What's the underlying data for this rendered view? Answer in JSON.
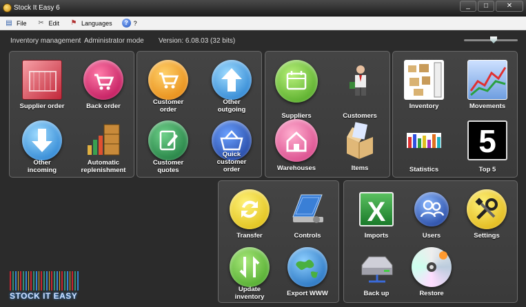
{
  "window": {
    "title": "Stock It Easy 6",
    "controls": {
      "minimize": "_",
      "maximize": "□",
      "close": "✕"
    }
  },
  "menu": {
    "items": [
      {
        "label": "File",
        "icon": "file-icon"
      },
      {
        "label": "Edit",
        "icon": "edit-tools-icon"
      },
      {
        "label": "Languages",
        "icon": "languages-icon"
      },
      {
        "label": "?",
        "icon": "help-icon"
      }
    ]
  },
  "info": {
    "mode": "Inventory management",
    "role": "Administrator mode",
    "version": "Version: 6.08.03 (32 bits)"
  },
  "panels": {
    "orders": [
      {
        "label": "Supplier order",
        "icon": "supplier-order-icon"
      },
      {
        "label": "Back order",
        "icon": "back-order-cart-icon"
      },
      {
        "label": "Other\nincoming",
        "icon": "down-arrow-icon"
      },
      {
        "label": "Automatic\nreplenishment",
        "icon": "replenishment-boxes-icon"
      }
    ],
    "customer": [
      {
        "label": "Customer\norder",
        "icon": "customer-order-cart-icon"
      },
      {
        "label": "Other\noutgoing",
        "icon": "up-arrow-icon"
      },
      {
        "label": "Customer\nquotes",
        "icon": "quote-note-icon"
      },
      {
        "label": "Quick\ncustomer\norder",
        "icon": "quick-basket-icon"
      }
    ],
    "contacts": [
      {
        "label": "Suppliers",
        "icon": "calendar-icon"
      },
      {
        "label": "Customers",
        "icon": "person-icon"
      },
      {
        "label": "Warehouses",
        "icon": "house-icon"
      },
      {
        "label": "Items",
        "icon": "open-box-icon"
      }
    ],
    "analysis": [
      {
        "label": "Inventory",
        "icon": "inventory-boxes-icon"
      },
      {
        "label": "Movements",
        "icon": "line-chart-icon"
      },
      {
        "label": "Statistics",
        "icon": "bar-chart-icon"
      },
      {
        "label": "Top 5",
        "icon": "top5-icon",
        "badge": "5"
      }
    ],
    "transfers": [
      {
        "label": "Transfer",
        "icon": "transfer-arrows-icon"
      },
      {
        "label": "Controls",
        "icon": "controls-panel-icon"
      },
      {
        "label": "Update\ninventory",
        "icon": "update-arrows-icon"
      },
      {
        "label": "Export WWW",
        "icon": "globe-icon"
      }
    ],
    "admin": [
      {
        "label": "Imports",
        "icon": "excel-icon",
        "glyph": "X"
      },
      {
        "label": "Users",
        "icon": "users-icon"
      },
      {
        "label": "Settings",
        "icon": "settings-tools-icon"
      },
      {
        "label": "Back up",
        "icon": "hard-drive-icon"
      },
      {
        "label": "Restore",
        "icon": "cd-icon"
      }
    ]
  },
  "branding": {
    "logo_text": "STOCK IT EASY"
  }
}
